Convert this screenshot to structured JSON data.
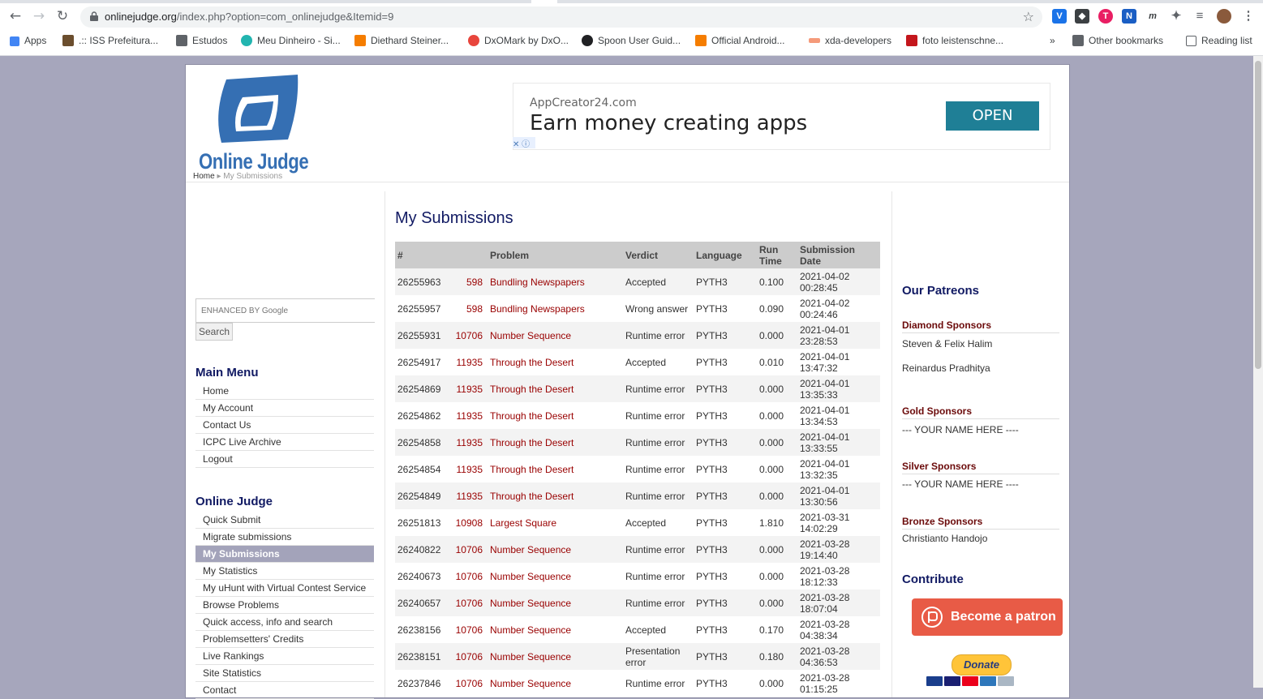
{
  "browser": {
    "url_host": "onlinejudge.org",
    "url_path": "/index.php?option=com_onlinejudge&Itemid=9",
    "bookmarks": [
      {
        "label": "Apps",
        "color": "#4285f4"
      },
      {
        "label": ".:: ISS Prefeitura...",
        "color": "#6b4e2e"
      },
      {
        "label": "Estudos",
        "color": "#5f6368"
      },
      {
        "label": "Meu Dinheiro - Si...",
        "color": "#22b5b0"
      },
      {
        "label": "Diethard Steiner...",
        "color": "#f57d00"
      },
      {
        "label": "DxOMark by DxO...",
        "color": "#e8453c"
      },
      {
        "label": "Spoon User Guid...",
        "color": "#202124"
      },
      {
        "label": "Official Android...",
        "color": "#f57d00"
      },
      {
        "label": "xda-developers",
        "color": "#f59a7a"
      },
      {
        "label": "foto leistenschne...",
        "color": "#c4161c"
      }
    ],
    "more_bookmarks": "»",
    "other_bookmarks": "Other bookmarks",
    "reading_list": "Reading list"
  },
  "header": {
    "logo_text": "Online Judge",
    "breadcrumb_home": "Home",
    "breadcrumb_current": "My Submissions",
    "ad": {
      "source": "AppCreator24.com",
      "headline": "Earn money creating apps",
      "cta": "OPEN"
    }
  },
  "search": {
    "placeholder": "ENHANCED BY Google",
    "button": "Search"
  },
  "main_menu": {
    "title": "Main Menu",
    "items": [
      "Home",
      "My Account",
      "Contact Us",
      "ICPC Live Archive",
      "Logout"
    ]
  },
  "oj_menu": {
    "title": "Online Judge",
    "items": [
      "Quick Submit",
      "Migrate submissions",
      "My Submissions",
      "My Statistics",
      "My uHunt with Virtual Contest Service",
      "Browse Problems",
      "Quick access, info and search",
      "Problemsetters' Credits",
      "Live Rankings",
      "Site Statistics",
      "Contact"
    ],
    "active": "My Submissions"
  },
  "submissions": {
    "title": "My Submissions",
    "columns": {
      "id": "#",
      "problem": "Problem",
      "verdict": "Verdict",
      "language": "Language",
      "runtime": "Run Time",
      "date": "Submission Date"
    },
    "rows": [
      {
        "id": "26255963",
        "num": "598",
        "title": "Bundling Newspapers",
        "verdict": "Accepted",
        "lang": "PYTH3",
        "time": "0.100",
        "date": "2021-04-02",
        "clock": "00:28:45"
      },
      {
        "id": "26255957",
        "num": "598",
        "title": "Bundling Newspapers",
        "verdict": "Wrong answer",
        "lang": "PYTH3",
        "time": "0.090",
        "date": "2021-04-02",
        "clock": "00:24:46"
      },
      {
        "id": "26255931",
        "num": "10706",
        "title": "Number Sequence",
        "verdict": "Runtime error",
        "lang": "PYTH3",
        "time": "0.000",
        "date": "2021-04-01",
        "clock": "23:28:53"
      },
      {
        "id": "26254917",
        "num": "11935",
        "title": "Through the Desert",
        "verdict": "Accepted",
        "lang": "PYTH3",
        "time": "0.010",
        "date": "2021-04-01",
        "clock": "13:47:32"
      },
      {
        "id": "26254869",
        "num": "11935",
        "title": "Through the Desert",
        "verdict": "Runtime error",
        "lang": "PYTH3",
        "time": "0.000",
        "date": "2021-04-01",
        "clock": "13:35:33"
      },
      {
        "id": "26254862",
        "num": "11935",
        "title": "Through the Desert",
        "verdict": "Runtime error",
        "lang": "PYTH3",
        "time": "0.000",
        "date": "2021-04-01",
        "clock": "13:34:53"
      },
      {
        "id": "26254858",
        "num": "11935",
        "title": "Through the Desert",
        "verdict": "Runtime error",
        "lang": "PYTH3",
        "time": "0.000",
        "date": "2021-04-01",
        "clock": "13:33:55"
      },
      {
        "id": "26254854",
        "num": "11935",
        "title": "Through the Desert",
        "verdict": "Runtime error",
        "lang": "PYTH3",
        "time": "0.000",
        "date": "2021-04-01",
        "clock": "13:32:35"
      },
      {
        "id": "26254849",
        "num": "11935",
        "title": "Through the Desert",
        "verdict": "Runtime error",
        "lang": "PYTH3",
        "time": "0.000",
        "date": "2021-04-01",
        "clock": "13:30:56"
      },
      {
        "id": "26251813",
        "num": "10908",
        "title": "Largest Square",
        "verdict": "Accepted",
        "lang": "PYTH3",
        "time": "1.810",
        "date": "2021-03-31",
        "clock": "14:02:29"
      },
      {
        "id": "26240822",
        "num": "10706",
        "title": "Number Sequence",
        "verdict": "Runtime error",
        "lang": "PYTH3",
        "time": "0.000",
        "date": "2021-03-28",
        "clock": "19:14:40"
      },
      {
        "id": "26240673",
        "num": "10706",
        "title": "Number Sequence",
        "verdict": "Runtime error",
        "lang": "PYTH3",
        "time": "0.000",
        "date": "2021-03-28",
        "clock": "18:12:33"
      },
      {
        "id": "26240657",
        "num": "10706",
        "title": "Number Sequence",
        "verdict": "Runtime error",
        "lang": "PYTH3",
        "time": "0.000",
        "date": "2021-03-28",
        "clock": "18:07:04"
      },
      {
        "id": "26238156",
        "num": "10706",
        "title": "Number Sequence",
        "verdict": "Accepted",
        "lang": "PYTH3",
        "time": "0.170",
        "date": "2021-03-28",
        "clock": "04:38:34"
      },
      {
        "id": "26238151",
        "num": "10706",
        "title": "Number Sequence",
        "verdict": "Presentation error",
        "lang": "PYTH3",
        "time": "0.180",
        "date": "2021-03-28",
        "clock": "04:36:53"
      },
      {
        "id": "26237846",
        "num": "10706",
        "title": "Number Sequence",
        "verdict": "Runtime error",
        "lang": "PYTH3",
        "time": "0.000",
        "date": "2021-03-28",
        "clock": "01:15:25"
      }
    ]
  },
  "patreons": {
    "title": "Our Patreons",
    "diamond_title": "Diamond Sponsors",
    "diamond": [
      "Steven & Felix Halim",
      "Reinardus Pradhitya"
    ],
    "gold_title": "Gold Sponsors",
    "gold": "--- YOUR NAME HERE ----",
    "silver_title": "Silver Sponsors",
    "silver": "--- YOUR NAME HERE ----",
    "bronze_title": "Bronze Sponsors",
    "bronze": "Christianto Handojo",
    "contribute_title": "Contribute",
    "patron_button": "Become a patron",
    "donate_button": "Donate"
  }
}
